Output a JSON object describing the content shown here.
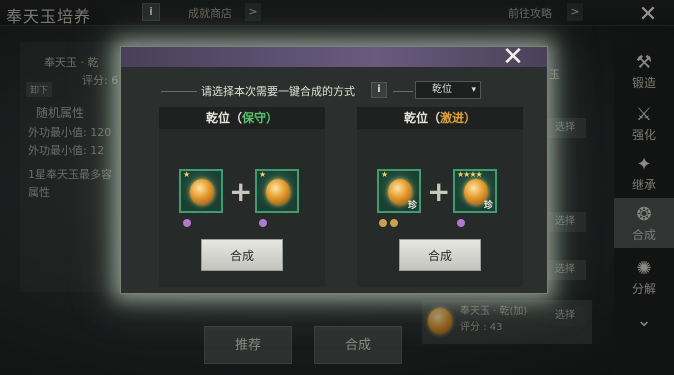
{
  "top_bar": {
    "title": "奉天玉培养",
    "info_label": "i",
    "achievement_shop": "成就商店",
    "guide": "前往攻略",
    "arrow": ">",
    "close": "✕"
  },
  "left_panel": {
    "name_partial": "奉天玉 · 乾",
    "score_partial": "评分: 6",
    "unequip_chip": "卸下",
    "random_attr": "随机属性",
    "attr1": "外功最小值: 120",
    "attr2": "外功最小值: 12",
    "note_line1": "1星奉天玉最多容",
    "note_line2": "属性"
  },
  "bottom_buttons": {
    "recommend": "推荐",
    "combine": "合成"
  },
  "right_list": {
    "select_label": "选择",
    "partial_yu": "玉",
    "entry_name": "奉天玉 · 乾(加)",
    "entry_score": "评分 : 43"
  },
  "nav": {
    "items": [
      {
        "icon": "anvil-icon",
        "glyph": "⚒",
        "label": "锻造"
      },
      {
        "icon": "hammer-icon",
        "glyph": "⚔",
        "label": "强化"
      },
      {
        "icon": "inherit-icon",
        "glyph": "✦",
        "label": "继承"
      },
      {
        "icon": "combine-icon",
        "glyph": "❂",
        "label": "合成"
      },
      {
        "icon": "decompose-icon",
        "glyph": "✺",
        "label": "分解"
      },
      {
        "icon": "more-icon",
        "glyph": "⌄",
        "label": ""
      }
    ]
  },
  "modal": {
    "prompt": "请选择本次需要一键合成的方式",
    "info_label": "i",
    "selected_position": "乾位",
    "chevron": "▾",
    "plus": "+",
    "options": [
      {
        "title_prefix": "乾位（",
        "mode": "保守",
        "title_suffix": "）",
        "mode_color": "#56c36f",
        "stars_left": "★",
        "stars_right": "★",
        "tag_left": "",
        "tag_right": "",
        "dots": [
          "purple",
          "purple"
        ],
        "button": "合成"
      },
      {
        "title_prefix": "乾位（",
        "mode": "激进",
        "title_suffix": "）",
        "mode_color": "#e0a23c",
        "stars_left": "★",
        "stars_right": "★★★★",
        "tag_left": "珍",
        "tag_right": "珍",
        "dots": [
          "gold",
          "gold",
          "purple"
        ],
        "button": "合成"
      }
    ]
  }
}
